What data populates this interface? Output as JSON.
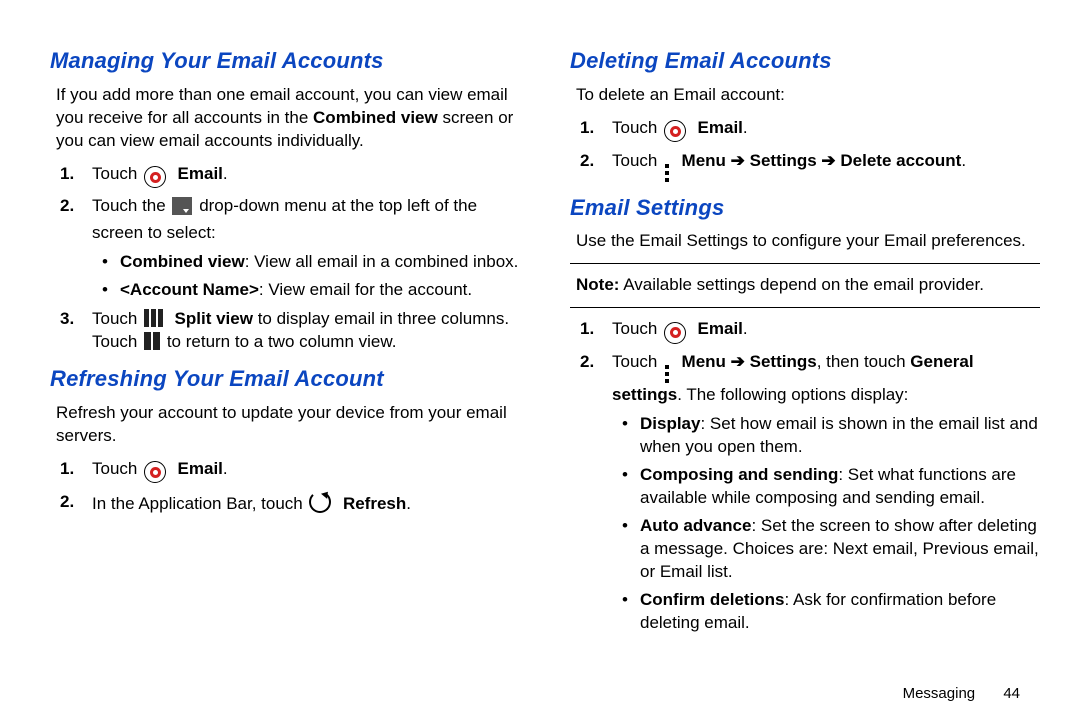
{
  "left": {
    "h1": "Managing Your Email Accounts",
    "intro_a": "If you add more than one email account, you can view email you receive for all accounts in the ",
    "intro_b": "Combined view",
    "intro_c": " screen or you can view email accounts individually.",
    "s1_a": "Touch ",
    "s1_b": "Email",
    "s2_a": "Touch the ",
    "s2_b": " drop-down menu at the top left of the screen to select:",
    "s2_bullet1_a": "Combined view",
    "s2_bullet1_b": ": View all email in a combined inbox.",
    "s2_bullet2_a": "<Account Name>",
    "s2_bullet2_b": ": View email for the account.",
    "s3_a": "Touch ",
    "s3_b": "Split view",
    "s3_c": " to display email in three columns. Touch ",
    "s3_d": " to return to a two column view.",
    "h2": "Refreshing Your Email Account",
    "refresh_intro": "Refresh your account to update your device from your email servers.",
    "r1_a": "Touch ",
    "r1_b": "Email",
    "r2_a": "In the Application Bar, touch ",
    "r2_b": "Refresh"
  },
  "right": {
    "h1": "Deleting Email Accounts",
    "intro": "To delete an Email account:",
    "d1_a": "Touch ",
    "d1_b": "Email",
    "d2_a": "Touch ",
    "d2_b": "Menu ➔ Settings ➔ Delete account",
    "h2": "Email Settings",
    "es_intro": "Use the Email Settings to configure your Email preferences.",
    "note_a": "Note:",
    "note_b": " Available settings depend on the email provider.",
    "e1_a": "Touch ",
    "e1_b": "Email",
    "e2_a": "Touch ",
    "e2_b": "Menu ➔ Settings",
    "e2_c": ", then touch ",
    "e2_d": "General settings",
    "e2_e": ". The following options display:",
    "b1_a": "Display",
    "b1_b": ": Set how email is shown in the email list and when you open them.",
    "b2_a": "Composing and sending",
    "b2_b": ": Set what functions are available while composing and sending email.",
    "b3_a": "Auto advance",
    "b3_b": ": Set the screen to show after deleting a message. Choices are: Next email, Previous email, or Email list.",
    "b4_a": "Confirm deletions",
    "b4_b": ": Ask for confirmation before deleting email."
  },
  "footer": {
    "section": "Messaging",
    "page": "44"
  }
}
